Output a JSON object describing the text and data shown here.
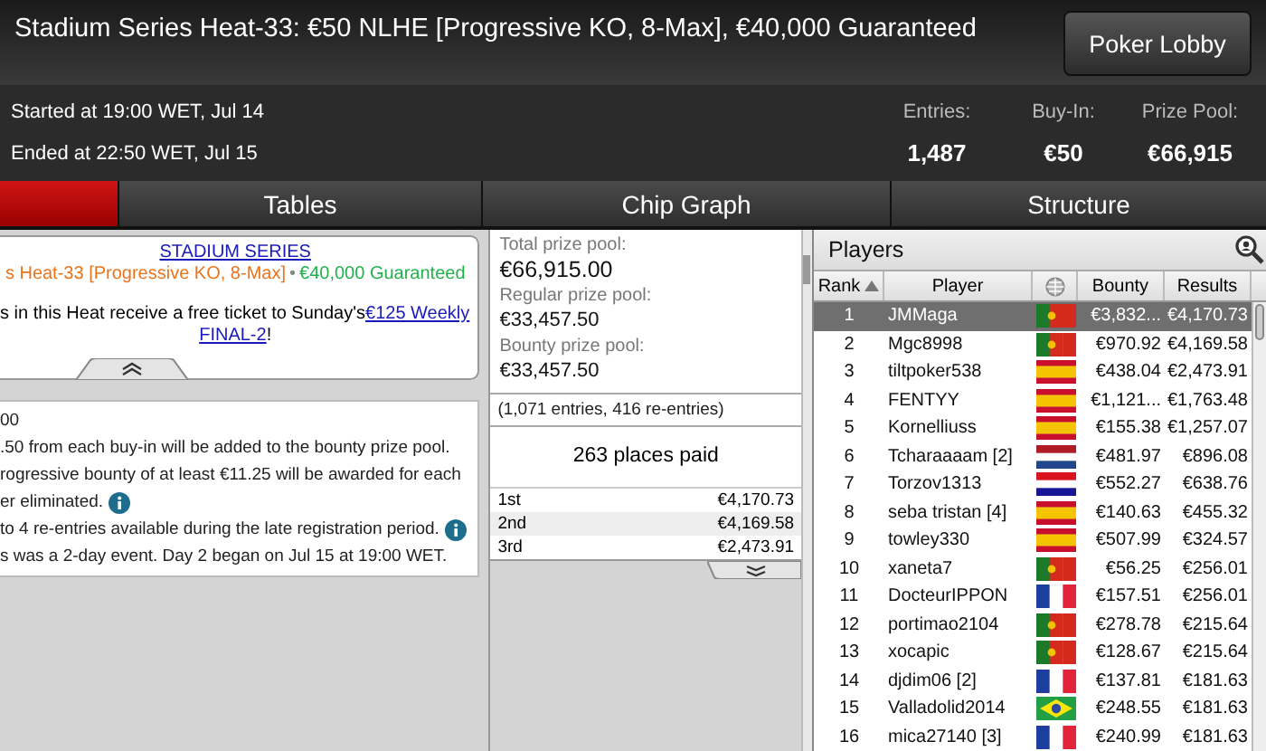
{
  "window": {
    "title": "Stadium Series Heat-33: €50 NLHE [Progressive KO, 8-Max], €40,000 Guaranteed",
    "lobby_button": "Poker Lobby"
  },
  "times": [
    "Started at 19:00 WET, Jul 14",
    "Ended at 22:50 WET, Jul 15"
  ],
  "stats": [
    {
      "label": "Entries:",
      "value": "1,487"
    },
    {
      "label": "Buy-In:",
      "value": "€50"
    },
    {
      "label": "Prize Pool:",
      "value": "€66,915"
    }
  ],
  "tabs": [
    {
      "selected": true
    },
    {
      "label": "Tables",
      "selected": false
    },
    {
      "label": "Chip Graph",
      "selected": false
    },
    {
      "label": "Structure",
      "selected": false
    }
  ],
  "banner": {
    "series_link": "STADIUM SERIES",
    "event": "s Heat-33 [Progressive KO, 8-Max]",
    "separator": "•",
    "guarantee": "€40,000 Guaranteed",
    "promo_text": "s in this Heat receive a free ticket to Sunday's",
    "promo_link_line1": "€125 Weekly",
    "promo_link_line2": "FINAL-2",
    "promo_end": "!"
  },
  "rules": [
    {
      "text": "00",
      "info": false
    },
    {
      "text": ".50 from each buy-in will be added to the bounty prize pool.",
      "info": false
    },
    {
      "text": "rogressive bounty of at least €11.25 will be awarded for each",
      "info": false
    },
    {
      "text": "er eliminated.",
      "info": true
    },
    {
      "text": "to 4 re-entries available during the late registration period.",
      "info": true
    },
    {
      "text": "s was a 2-day event. Day 2 began on Jul 15 at 19:00 WET.",
      "info": false
    }
  ],
  "prize_pools": [
    {
      "label": "Total prize pool:",
      "value": "€66,915.00",
      "large": true
    },
    {
      "label": "Regular prize pool:",
      "value": "€33,457.50",
      "large": false
    },
    {
      "label": "Bounty prize pool:",
      "value": "€33,457.50",
      "large": false
    }
  ],
  "entries_note": "(1,071 entries, 416 re-entries)",
  "places_paid": "263 places paid",
  "payouts": [
    {
      "place": "1st",
      "amount": "€4,170.73"
    },
    {
      "place": "2nd",
      "amount": "€4,169.58"
    },
    {
      "place": "3rd",
      "amount": "€2,473.91"
    }
  ],
  "players": {
    "title": "Players",
    "columns": [
      "Rank",
      "Player",
      "Bounty",
      "Results"
    ],
    "rows": [
      {
        "rank": "1",
        "name": "JMMaga",
        "kind": "pt",
        "bounty": "€3,832...",
        "result": "€4,170.73",
        "selected": true
      },
      {
        "rank": "2",
        "name": "Mgc8998",
        "kind": "pt",
        "bounty": "€970.92",
        "result": "€4,169.58",
        "selected": false
      },
      {
        "rank": "3",
        "name": "tiltpoker538",
        "kind": "es",
        "bounty": "€438.04",
        "result": "€2,473.91",
        "selected": false
      },
      {
        "rank": "4",
        "name": "FENTYY",
        "kind": "es",
        "bounty": "€1,121...",
        "result": "€1,763.48",
        "selected": false
      },
      {
        "rank": "5",
        "name": "Kornelliuss",
        "kind": "es",
        "bounty": "€155.38",
        "result": "€1,257.07",
        "selected": false
      },
      {
        "rank": "6",
        "name": "Tcharaaaam [2]",
        "kind": "nl",
        "bounty": "€481.97",
        "result": "€896.08",
        "selected": false
      },
      {
        "rank": "7",
        "name": "Torzov1313",
        "kind": "hr",
        "bounty": "€552.27",
        "result": "€638.76",
        "selected": false
      },
      {
        "rank": "8",
        "name": "seba tristan [4]",
        "kind": "es",
        "bounty": "€140.63",
        "result": "€455.32",
        "selected": false
      },
      {
        "rank": "9",
        "name": "towley330",
        "kind": "es",
        "bounty": "€507.99",
        "result": "€324.57",
        "selected": false
      },
      {
        "rank": "10",
        "name": "xaneta7",
        "kind": "pt",
        "bounty": "€56.25",
        "result": "€256.01",
        "selected": false
      },
      {
        "rank": "11",
        "name": "DocteurIPPON",
        "kind": "fr",
        "bounty": "€157.51",
        "result": "€256.01",
        "selected": false
      },
      {
        "rank": "12",
        "name": "portimao2104",
        "kind": "pt",
        "bounty": "€278.78",
        "result": "€215.64",
        "selected": false
      },
      {
        "rank": "13",
        "name": "xocapic",
        "kind": "pt",
        "bounty": "€128.67",
        "result": "€215.64",
        "selected": false
      },
      {
        "rank": "14",
        "name": "djdim06 [2]",
        "kind": "fr",
        "bounty": "€137.81",
        "result": "€181.63",
        "selected": false
      },
      {
        "rank": "15",
        "name": "Valladolid2014",
        "kind": "br",
        "bounty": "€248.55",
        "result": "€181.63",
        "selected": false
      },
      {
        "rank": "16",
        "name": "mica27140 [3]",
        "kind": "fr",
        "bounty": "€240.99",
        "result": "€181.63",
        "selected": false
      }
    ]
  }
}
